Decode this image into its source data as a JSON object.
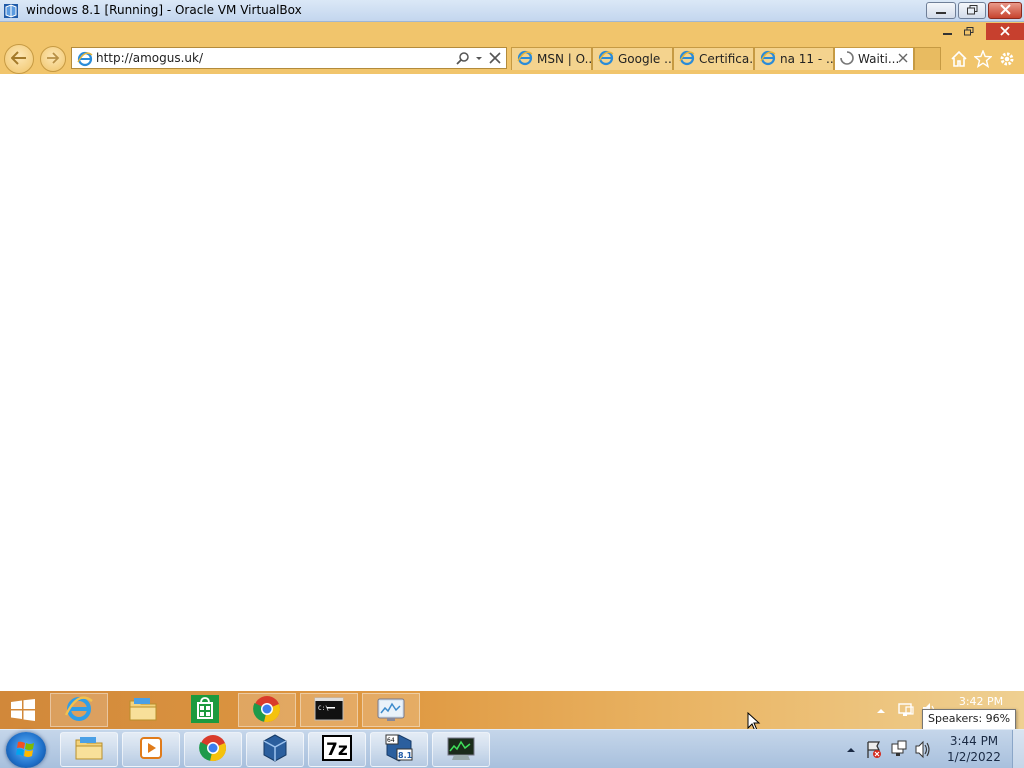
{
  "host_window": {
    "title": "windows 8.1 [Running] - Oracle VM VirtualBox",
    "icon": "virtualbox-icon"
  },
  "browser": {
    "address": {
      "url": "http://amogus.uk/",
      "icon": "ie-page-icon"
    },
    "tabs": [
      {
        "label": "MSN | O...",
        "icon": "ie-page-icon",
        "active": false
      },
      {
        "label": "Google ...",
        "icon": "ie-page-icon",
        "active": false
      },
      {
        "label": "Certifica...",
        "icon": "ie-page-icon",
        "active": false
      },
      {
        "label": "na 11 - ...",
        "icon": "ie-page-icon",
        "active": false
      },
      {
        "label": "Waiti...",
        "icon": "loading-spinner-icon",
        "active": true
      }
    ],
    "toolbar_icons": [
      "home-icon",
      "favorites-star-icon",
      "settings-gear-icon"
    ]
  },
  "guest_taskbar": {
    "apps": [
      "internet-explorer",
      "file-explorer",
      "store",
      "chrome",
      "command-prompt",
      "resource-monitor"
    ],
    "clock_time": "3:42 PM",
    "tooltip": "Speakers: 96%"
  },
  "host_taskbar": {
    "apps": [
      "windows-explorer",
      "media-player",
      "chrome",
      "virtualbox",
      "7-zip",
      "windows-8.1-vm",
      "resource-monitor"
    ],
    "clock_time": "3:44 PM",
    "clock_date": "1/2/2022"
  },
  "colors": {
    "ie_frame": "#f1c56c",
    "win8_taskbar": "#e09a43",
    "win7_taskbar": "#b6cbe4",
    "close_red": "#c7402e"
  }
}
